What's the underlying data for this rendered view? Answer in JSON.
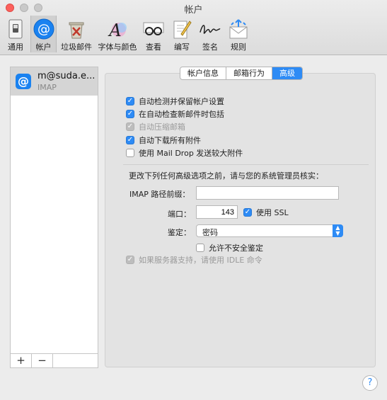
{
  "window": {
    "title": "帐户"
  },
  "toolbar": [
    {
      "label": "通用",
      "icon": "switch-icon"
    },
    {
      "label": "帐户",
      "icon": "at-icon",
      "selected": true
    },
    {
      "label": "垃圾邮件",
      "icon": "trash-icon"
    },
    {
      "label": "字体与颜色",
      "icon": "font-icon"
    },
    {
      "label": "查看",
      "icon": "glasses-icon"
    },
    {
      "label": "编写",
      "icon": "compose-icon"
    },
    {
      "label": "签名",
      "icon": "signature-icon"
    },
    {
      "label": "规则",
      "icon": "rules-icon"
    }
  ],
  "sidebar": {
    "account": {
      "name": "m@suda.e...",
      "type": "IMAP"
    },
    "add_label": "+",
    "remove_label": "−"
  },
  "tabs": [
    "帐户信息",
    "邮箱行为",
    "高级"
  ],
  "active_tab": "高级",
  "options": [
    {
      "label": "自动检测并保留帐户设置",
      "checked": true,
      "enabled": true
    },
    {
      "label": "在自动检查新邮件时包括",
      "checked": true,
      "enabled": true
    },
    {
      "label": "自动压缩邮箱",
      "checked": true,
      "enabled": false
    },
    {
      "label": "自动下载所有附件",
      "checked": true,
      "enabled": true
    },
    {
      "label": "使用 Mail Drop 发送较大附件",
      "checked": false,
      "enabled": true
    }
  ],
  "notice": "更改下列任何高级选项之前，请与您的系统管理员核实：",
  "fields": {
    "imap_prefix_label": "IMAP 路径前缀：",
    "imap_prefix_value": "",
    "port_label": "端口：",
    "port_value": "143",
    "ssl_label": "使用 SSL",
    "ssl_checked": true,
    "auth_label": "鉴定：",
    "auth_value": "密码",
    "insecure_label": "允许不安全鉴定",
    "insecure_checked": false,
    "idle_label": "如果服务器支持，请使用 IDLE 命令",
    "idle_checked": true
  },
  "help_label": "?",
  "colors": {
    "accent": "#2e8bf5",
    "close": "#fc605c"
  }
}
